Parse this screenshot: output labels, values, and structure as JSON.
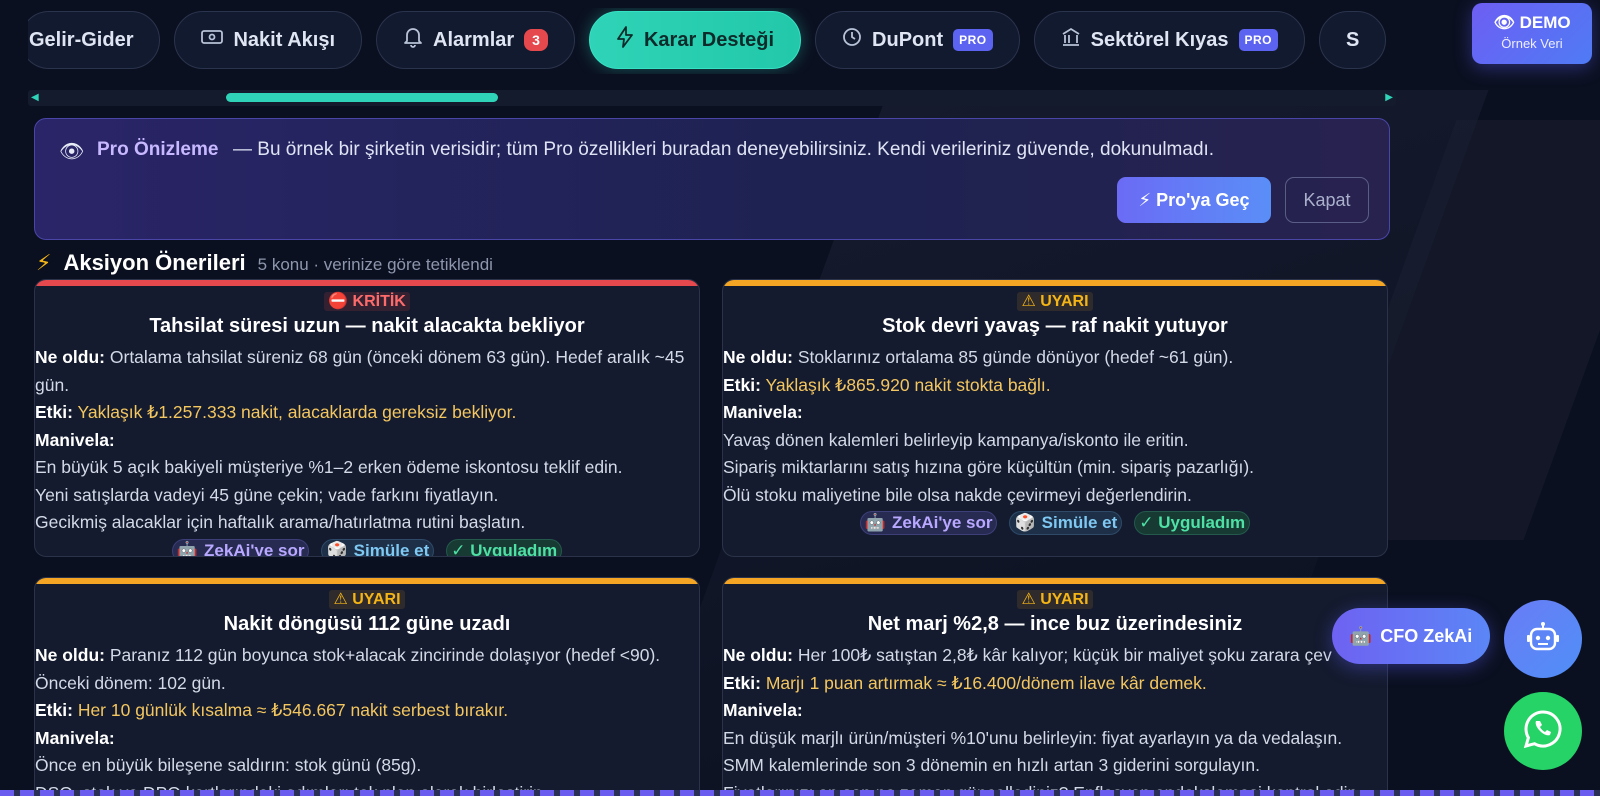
{
  "tabs": [
    {
      "label": "Gelir-Gider",
      "icon": "none",
      "active": false
    },
    {
      "label": "Nakit Akışı",
      "icon": "cash-icon",
      "active": false
    },
    {
      "label": "Alarmlar",
      "icon": "bell-icon",
      "badge": "3",
      "active": false
    },
    {
      "label": "Karar Desteği",
      "icon": "lightning-icon",
      "active": true
    },
    {
      "label": "DuPont",
      "icon": "clock-icon",
      "pro": "PRO",
      "active": false
    },
    {
      "label": "Sektörel Kıyas",
      "icon": "bank-icon",
      "pro": "PRO",
      "active": false
    },
    {
      "label": "S",
      "icon": "none",
      "active": false
    }
  ],
  "demo": {
    "label": "DEMO",
    "sub": "Örnek Veri",
    "icon": "eye-icon"
  },
  "banner": {
    "title": "Pro Önizleme",
    "message": "— Bu örnek bir şirketin verisidir; tüm Pro özellikleri buradan deneyebilirsiniz. Kendi verileriniz güvende, dokunulmadı.",
    "pro_button": "Pro'ya Geç",
    "close_button": "Kapat"
  },
  "section": {
    "title": "Aksiyon Önerileri",
    "subtitle": "5 konu · verinize göre tetiklendi"
  },
  "labels": {
    "what": "Ne oldu:",
    "impact": "Etki:",
    "lever": "Manivela:"
  },
  "card_actions": {
    "ask": "ZekAi'ye sor",
    "simulate": "Simüle et",
    "done": "✓ Uyguladım"
  },
  "cards": [
    {
      "severity": "KRİTİK",
      "title": "Tahsilat süresi uzun — nakit alacakta bekliyor",
      "what": "Ortalama tahsilat süreniz 68 gün (önceki dönem 63 gün). Hedef aralık ~45 gün.",
      "impact": "Yaklaşık ₺1.257.333 nakit, alacaklarda gereksiz bekliyor.",
      "levers": [
        "En büyük 5 açık bakiyeli müşteriye %1–2 erken ödeme iskontosu teklif edin.",
        "Yeni satışlarda vadeyi 45 güne çekin; vade farkını fiyatlayın.",
        "Gecikmiş alacaklar için haftalık arama/hatırlatma rutini başlatın."
      ]
    },
    {
      "severity": "UYARI",
      "title": "Stok devri yavaş — raf nakit yutuyor",
      "what": "Stoklarınız ortalama 85 günde dönüyor (hedef ~61 gün).",
      "impact": "Yaklaşık ₺865.920 nakit stokta bağlı.",
      "levers": [
        "Yavaş dönen kalemleri belirleyip kampanya/iskonto ile eritin.",
        "Sipariş miktarlarını satış hızına göre küçültün (min. sipariş pazarlığı).",
        "Ölü stoku maliyetine bile olsa nakde çevirmeyi değerlendirin."
      ]
    },
    {
      "severity": "UYARI",
      "title": "Nakit döngüsü 112 güne uzadı",
      "what": "Paranız 112 gün boyunca stok+alacak zincirinde dolaşıyor (hedef <90). Önceki dönem: 102 gün.",
      "impact": "Her 10 günlük kısalma ≈ ₺546.667 nakit serbest bırakır.",
      "levers": [
        "Önce en büyük bileşene saldırın: stok günü (85g).",
        "DSO, stok ve DPO kartlarındaki adımları tek plan olarak birleştirin."
      ]
    },
    {
      "severity": "UYARI",
      "title": "Net marj %2,8 — ince buz üzerindesiniz",
      "what": "Her 100₺ satıştan 2,8₺ kâr kalıyor; küçük bir maliyet şoku zarara çev",
      "impact": "Marjı 1 puan artırmak ≈ ₺16.400/dönem ilave kâr demek.",
      "levers": [
        "En düşük marjlı ürün/müşteri %10'unu belirleyin: fiyat ayarlayın ya da vedalaşın.",
        "SMM kalemlerinde son 3 dönemin en hızlı artan 3 giderini sorgulayın.",
        "Fiyatlarınızı en son ne zaman güncellediniz? Enflasyon endekslemesi kontrol edin."
      ]
    }
  ],
  "floating": {
    "cfo_label": "CFO ZekAi",
    "robot_icon": "robot-icon",
    "whatsapp_icon": "whatsapp-icon"
  },
  "colors": {
    "accent": "#2fd3b7",
    "critical": "#e5484d",
    "warning": "#f5a524",
    "pro": "#5b63f0"
  }
}
